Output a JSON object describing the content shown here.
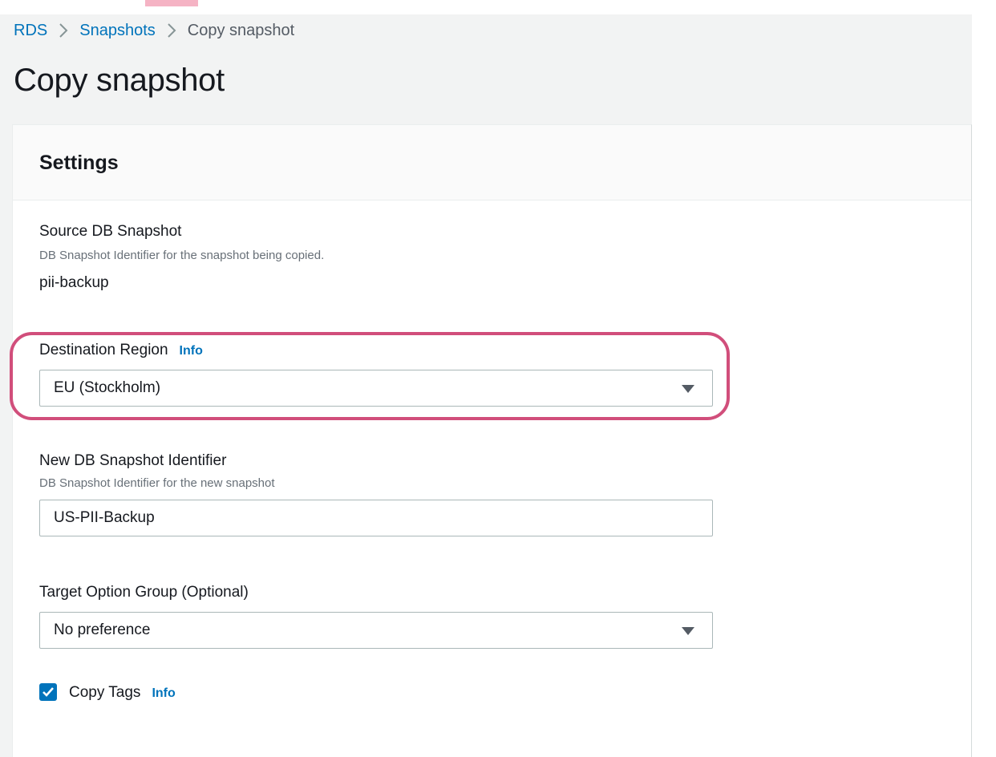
{
  "breadcrumb": {
    "items": [
      {
        "label": "RDS"
      },
      {
        "label": "Snapshots"
      },
      {
        "label": "Copy snapshot"
      }
    ]
  },
  "page": {
    "title": "Copy snapshot"
  },
  "settings": {
    "title": "Settings",
    "source": {
      "label": "Source DB Snapshot",
      "description": "DB Snapshot Identifier for the snapshot being copied.",
      "value": "pii-backup"
    },
    "destination_region": {
      "label": "Destination Region",
      "info": "Info",
      "selected": "EU (Stockholm)"
    },
    "new_identifier": {
      "label": "New DB Snapshot Identifier",
      "description": "DB Snapshot Identifier for the new snapshot",
      "value": "US-PII-Backup"
    },
    "option_group": {
      "label": "Target Option Group (Optional)",
      "selected": "No preference"
    },
    "copy_tags": {
      "label": "Copy Tags",
      "info": "Info",
      "checked": true
    }
  },
  "colors": {
    "link": "#0073bb",
    "highlight": "#d14e7b",
    "page_bg": "#f2f3f3"
  }
}
